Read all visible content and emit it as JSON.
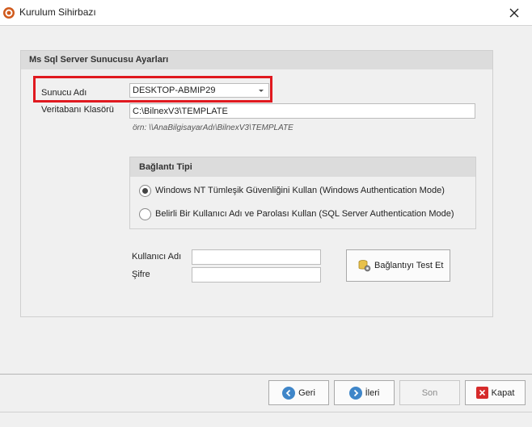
{
  "window": {
    "title": "Kurulum Sihirbazı",
    "icons": {
      "app": "setup-wizard-icon",
      "close": "close-icon"
    }
  },
  "group": {
    "title": "Ms Sql Server Sunucusu Ayarları",
    "server_label": "Sunucu Adı",
    "server_value": "DESKTOP-ABMIP29",
    "db_folder_label": "Veritabanı Klasörü",
    "db_folder_value": "C:\\BilnexV3\\TEMPLATE",
    "hint": "örn: \\\\AnaBilgisayarAdı\\BilnexV3\\TEMPLATE"
  },
  "connection_type": {
    "title": "Bağlantı Tipi",
    "options": [
      {
        "label": "Windows NT Tümleşik Güvenliğini Kullan (Windows Authentication Mode)",
        "selected": true
      },
      {
        "label": "Belirli Bir Kullanıcı Adı ve Parolası Kullan (SQL Server Authentication Mode)",
        "selected": false
      }
    ]
  },
  "credentials": {
    "username_label": "Kullanıcı Adı",
    "username_value": "",
    "password_label": "Şifre",
    "password_value": ""
  },
  "test_button": {
    "label": "Bağlantıyı Test Et",
    "icon": "database-gear-icon"
  },
  "footer": {
    "back_label": "Geri",
    "next_label": "İleri",
    "finish_label": "Son",
    "close_label": "Kapat"
  },
  "colors": {
    "highlight": "#e0191f",
    "nav_icon": "#3f86c9",
    "close_icon": "#d62b2b",
    "app_icon": "#d05a1c"
  }
}
